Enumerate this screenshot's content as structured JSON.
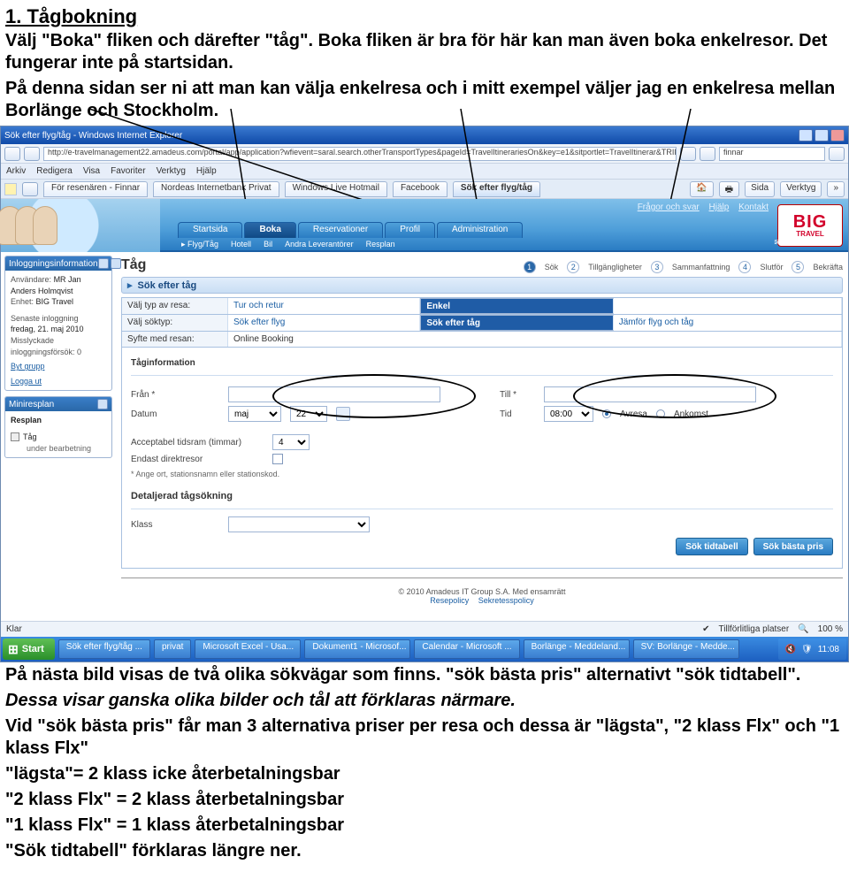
{
  "doc": {
    "heading": "1. Tågbokning",
    "para1": "Välj \"Boka\" fliken  och därefter \"tåg\". Boka fliken är bra för här kan man även boka enkelresor. Det fungerar inte på startsidan.",
    "para2": "På denna sidan ser ni att man kan välja enkelresa och i mitt exempel väljer jag en enkelresa mellan Borlänge och Stockholm.",
    "para_bottom1": "På nästa bild visas de två olika sökvägar som finns. \"sök bästa pris\" alternativt \"sök tidtabell\".",
    "para_bottom2": "Dessa visar ganska olika bilder och tål att förklaras närmare.",
    "para_bottom3": "Vid \"sök bästa pris\" får man 3 alternativa priser per resa och dessa är \"lägsta\", \"2 klass Flx\" och \"1 klass Flx\"",
    "para_bottom4": "\"lägsta\"= 2 klass icke återbetalningsbar",
    "para_bottom5": "\"2 klass Flx\" = 2 klass återbetalningsbar",
    "para_bottom6": "\"1 klass Flx\" = 1 klass återbetalningsbar",
    "para_bottom7": "\"Sök tidtabell\" förklaras längre ner."
  },
  "browser": {
    "title": "Sök efter flyg/tåg - Windows Internet Explorer",
    "url": "http://e-travelmanagement22.amadeus.com/portal/app/application?wfievent=saral.search.otherTransportTypes&pageId=TravelItinerariesOn&key=e1&sitportlet=TravelItinerar&TRIP_TYPE=OBMIXED_SEARCH_OPTION=#RAILBB_ANY_TIME_1=FALSE&B_DA",
    "search": "finnar",
    "menu": [
      "Arkiv",
      "Redigera",
      "Visa",
      "Favoriter",
      "Verktyg",
      "Hjälp"
    ],
    "tabs": [
      "För resenären - Finnar",
      "Nordeas Internetbank Privat",
      "Windows Live Hotmail",
      "Facebook",
      "Sök efter flyg/tåg"
    ],
    "tools": {
      "home": "",
      "print": "",
      "page": "Sida",
      "tools": "Verktyg"
    }
  },
  "header": {
    "links": [
      "Frågor och svar",
      "Hjälp",
      "Kontakt"
    ],
    "logo_big": "BIG",
    "logo_sub": "TRAVEL",
    "nav": [
      "Startsida",
      "Boka",
      "Reservationer",
      "Profil",
      "Administration"
    ],
    "nav_active": 1,
    "subnav": [
      "Flyg/Tåg",
      "Hotell",
      "Bil",
      "Andra Leverantörer",
      "Resplan"
    ],
    "resinfo": "Reseinformation"
  },
  "sidebar": {
    "login_title": "Inloggningsinformation",
    "user_label": "Användare:",
    "user_value": "MR Jan Anders Holmqvist",
    "unit_label": "Enhet:",
    "unit_value": "BIG Travel",
    "last_login_label": "Senaste inloggning",
    "last_login_value": "fredag, 21. maj 2010",
    "failed_label": "Misslyckade inloggningsförsök: 0",
    "link_group": "Byt grupp",
    "link_logout": "Logga ut",
    "mini_title": "Miniresplan",
    "mini_heading": "Resplan",
    "mini_item": "Tåg",
    "mini_sub": "under bearbetning"
  },
  "main": {
    "page_title": "Tåg",
    "steps": [
      "Sök",
      "Tillgängligheter",
      "Sammanfattning",
      "Slutför",
      "Bekräfta"
    ],
    "section_search": "Sök efter tåg",
    "row_type_label": "Välj typ av resa:",
    "row_type_opts": [
      "Tur och retur",
      "Enkel"
    ],
    "row_type_sel": 1,
    "row_soktyp_label": "Välj söktyp:",
    "row_soktyp_opts": [
      "Sök efter flyg",
      "Sök efter tåg",
      "Jämför flyg och tåg"
    ],
    "row_soktyp_sel": 1,
    "row_syfte_label": "Syfte med resan:",
    "row_syfte_value": "Online Booking",
    "taginfo_title": "Tåginformation",
    "from_label": "Från *",
    "to_label": "Till *",
    "date_label": "Datum",
    "date_month": "maj",
    "date_day": "22",
    "time_label": "Tid",
    "time_value": "08:00",
    "radio_avresa": "Avresa",
    "radio_ankomst": "Ankomst",
    "accept_label": "Acceptabel tidsram (timmar)",
    "accept_value": "4",
    "direct_label": "Endast direktresor",
    "note": "* Ange ort, stationsnamn eller stationskod.",
    "detail_title": "Detaljerad tågsökning",
    "klass_label": "Klass",
    "btn_timetable": "Sök tidtabell",
    "btn_bestprice": "Sök bästa pris"
  },
  "footer": {
    "copyright": "© 2010 Amadeus IT Group S.A. Med ensamrätt",
    "link1": "Resepolicy",
    "link2": "Sekretesspolicy"
  },
  "status": {
    "left": "Klar",
    "trusted": "Tillförlitliga platser",
    "zoom": "100 %"
  },
  "taskbar": {
    "start": "Start",
    "items": [
      "Sök efter flyg/tåg ...",
      "privat",
      "Microsoft Excel - Usa...",
      "Dokument1 - Microsof...",
      "Calendar - Microsoft ...",
      "Borlänge - Meddeland...",
      "SV: Borlänge - Medde..."
    ],
    "time": "11:08"
  }
}
